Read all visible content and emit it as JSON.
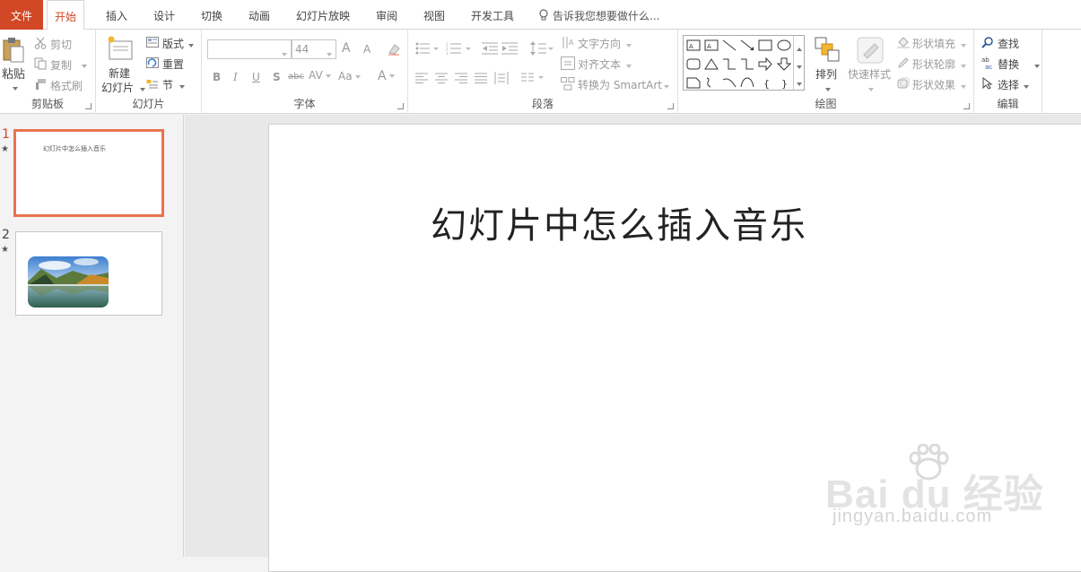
{
  "tabs": {
    "file": "文件",
    "home": "开始",
    "insert": "插入",
    "design": "设计",
    "transitions": "切换",
    "animations": "动画",
    "slideshow": "幻灯片放映",
    "review": "审阅",
    "view": "视图",
    "developer": "开发工具",
    "tell_me": "告诉我您想要做什么..."
  },
  "clipboard": {
    "paste": "粘贴",
    "cut": "剪切",
    "copy": "复制",
    "format_painter": "格式刷",
    "group_label": "剪贴板"
  },
  "slides_group": {
    "new_slide_line1": "新建",
    "new_slide_line2": "幻灯片",
    "layout": "版式",
    "reset": "重置",
    "section": "节",
    "group_label": "幻灯片"
  },
  "font": {
    "font_name": "",
    "font_size": "44",
    "grow": "A",
    "shrink": "A",
    "bold": "B",
    "italic": "I",
    "underline": "U",
    "shadow": "S",
    "strike": "abc",
    "spacing": "AV",
    "case": "Aa",
    "color": "A",
    "group_label": "字体"
  },
  "paragraph": {
    "text_direction": "文字方向",
    "align_text": "对齐文本",
    "convert_smartart": "转换为 SmartArt",
    "group_label": "段落"
  },
  "drawing": {
    "arrange": "排列",
    "quick_styles": "快速样式",
    "shape_fill": "形状填充",
    "shape_outline": "形状轮廓",
    "shape_effects": "形状效果",
    "group_label": "绘图"
  },
  "editing": {
    "find": "查找",
    "replace": "替换",
    "select": "选择",
    "group_label": "编辑"
  },
  "thumbnails": [
    {
      "number": "1",
      "title": "幻灯片中怎么插入音乐"
    },
    {
      "number": "2"
    }
  ],
  "slide": {
    "title": "幻灯片中怎么插入音乐"
  },
  "watermark": {
    "main": "Bai du 经验",
    "sub": "jingyan.baidu.com"
  },
  "colors": {
    "accent": "#d24726",
    "selected_border": "#e8734f"
  }
}
